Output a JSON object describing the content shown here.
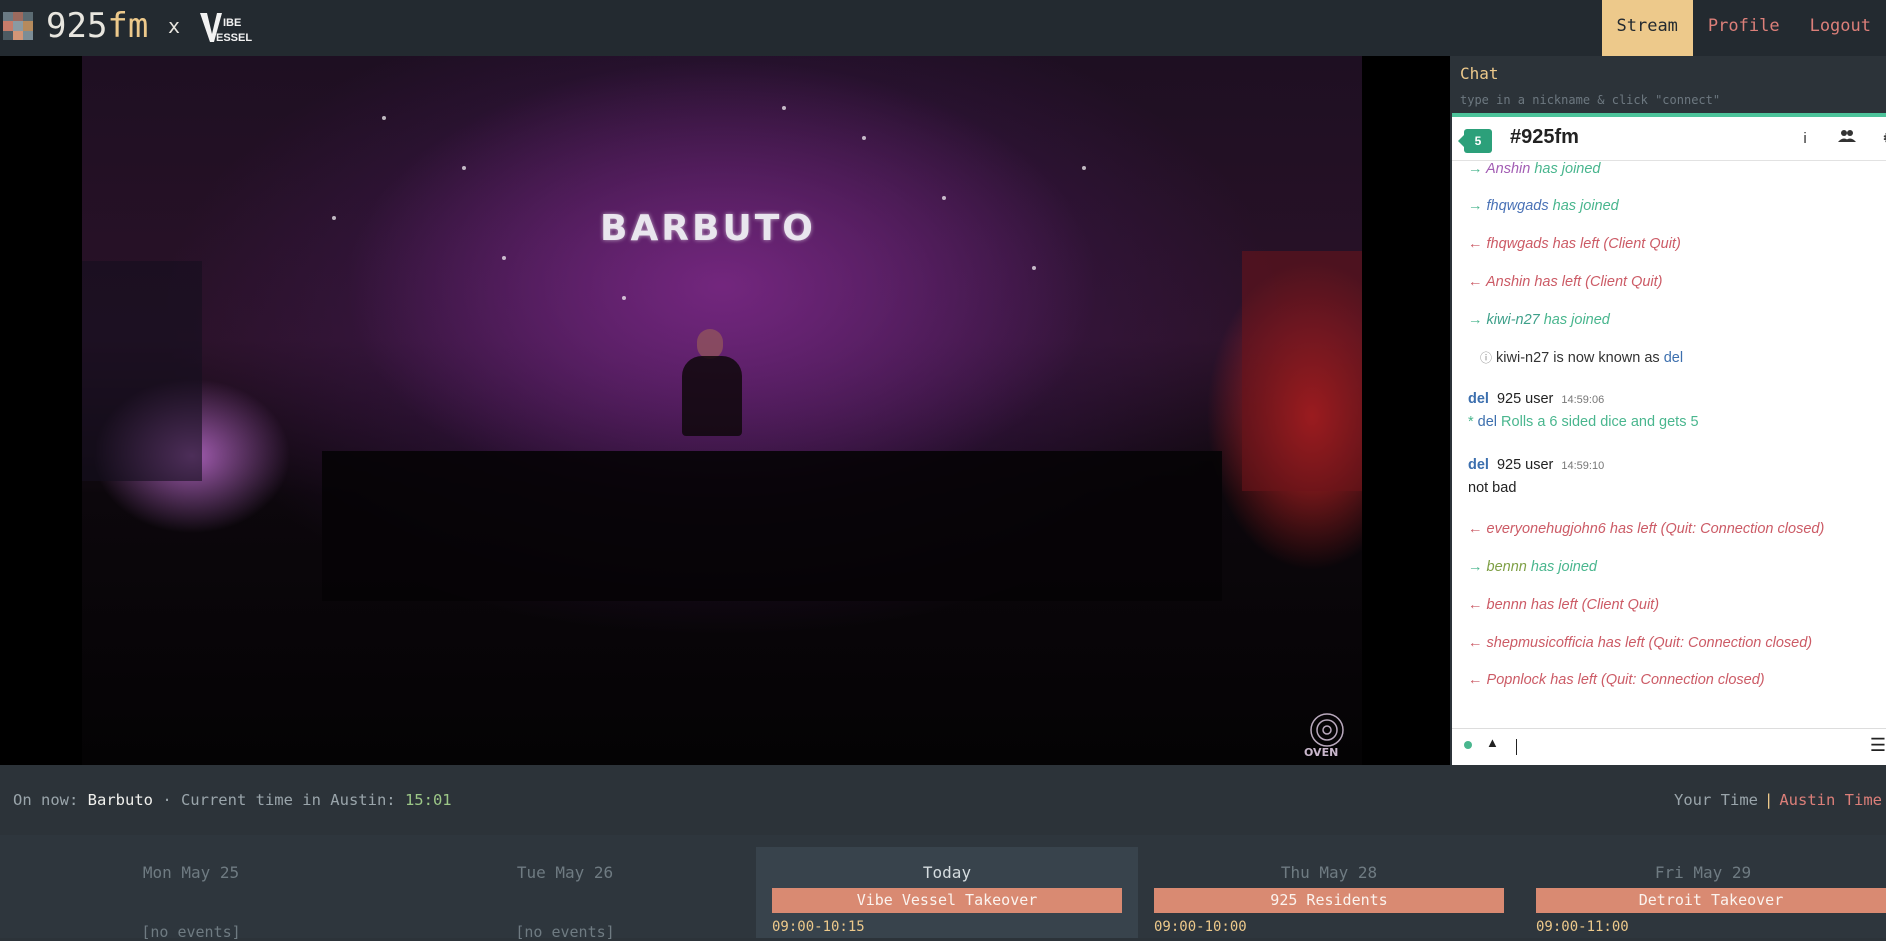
{
  "header": {
    "brand_main": "925",
    "brand_suffix": "fm",
    "times_sign": "x",
    "partner_logo": "vibe-vessel-logo",
    "nav": [
      {
        "label": "Stream",
        "active": true
      },
      {
        "label": "Profile",
        "active": false
      },
      {
        "label": "Logout",
        "active": false
      }
    ]
  },
  "video": {
    "banner_text": "BARBUTO",
    "watermark": "OVEN"
  },
  "chat": {
    "title": "Chat",
    "hint": "type in a nickname & click \"connect\"",
    "channel": {
      "badge_count": "5",
      "name": "#925fm",
      "icons": [
        "info-icon",
        "users-icon",
        "gear-icon"
      ]
    },
    "events": [
      {
        "arrow": "→",
        "nick": "Anshin",
        "text": " has joined"
      },
      {
        "arrow": "→",
        "nick": "fhqwgads",
        "text": " has joined"
      },
      {
        "arrow": "←",
        "nick": "fhqwgads",
        "text": " has left (Client Quit)"
      },
      {
        "arrow": "←",
        "nick": "Anshin",
        "text": " has left (Client Quit)"
      },
      {
        "arrow": "→",
        "nick": "kiwi-n27",
        "text": " has joined"
      }
    ],
    "notice": {
      "icon": "ⓘ",
      "text": "kiwi-n27 is now known as ",
      "new_nick": "del"
    },
    "messages": [
      {
        "nick": "del",
        "tag": "925 user",
        "time": "14:59:06",
        "action_prefix": "* ",
        "action_nick": "del",
        "body": " Rolls a 6 sided dice and gets 5"
      },
      {
        "nick": "del",
        "tag": "925 user",
        "time": "14:59:10",
        "body": "not bad"
      }
    ],
    "events_after": [
      {
        "arrow": "←",
        "nick": "everyonehugjohn6",
        "text": " has left (Quit: Connection closed)"
      },
      {
        "arrow": "→",
        "nick": "bennn",
        "text": " has joined"
      },
      {
        "arrow": "←",
        "nick": "bennn",
        "text": " has left (Client Quit)"
      },
      {
        "arrow": "←",
        "nick": "shepmusicofficia",
        "text": " has left (Quit: Connection closed)"
      },
      {
        "arrow": "←",
        "nick": "Popnlock",
        "text": " has left (Quit: Connection closed)"
      }
    ],
    "input": {
      "expand_glyph": "▲",
      "menu_glyph": "☰"
    }
  },
  "now": {
    "prefix": "On now: ",
    "show": "Barbuto",
    "middle": " · Current time in Austin: ",
    "time": "15:01",
    "tz_your": "Your Time",
    "tz_sep": "|",
    "tz_austin": "Austin Time"
  },
  "schedule": {
    "days": [
      {
        "label": "Mon May 25",
        "empty_text": "[no events]"
      },
      {
        "label": "Tue May 26",
        "empty_text": "[no events]"
      },
      {
        "label": "Today",
        "event": "Vibe Vessel Takeover",
        "time": "09:00-10:15",
        "today": true
      },
      {
        "label": "Thu May 28",
        "event": "925 Residents",
        "time": "09:00-10:00"
      },
      {
        "label": "Fri May 29",
        "event": "Detroit Takeover",
        "time": "09:00-11:00"
      }
    ]
  },
  "colors": {
    "accent_gold": "#edc98b",
    "link_red": "#dc7f79",
    "chat_accent": "#4cc39a",
    "event_fill": "#d98a72"
  }
}
